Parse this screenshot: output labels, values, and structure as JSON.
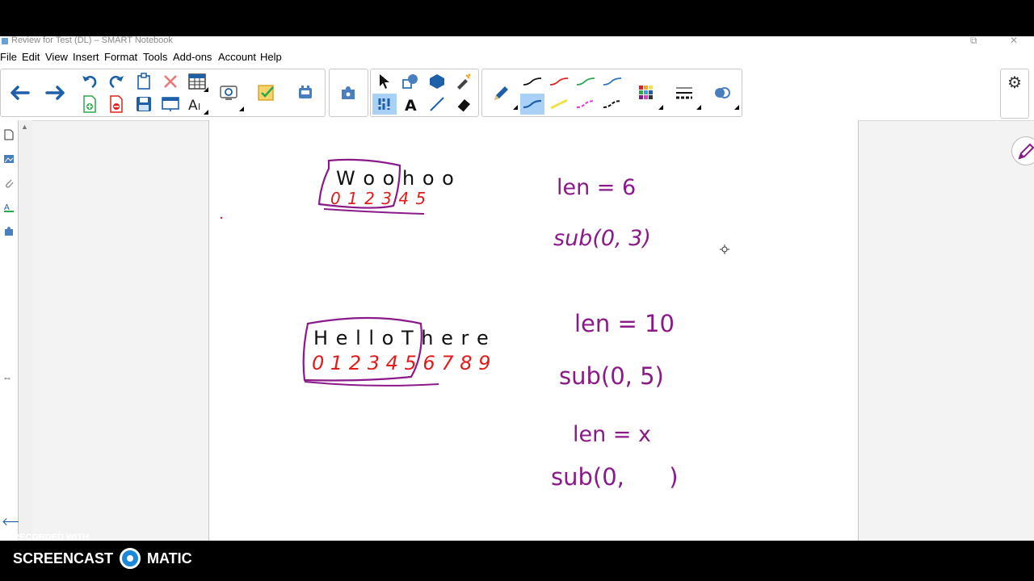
{
  "window": {
    "title": "Review for Test (DL) – SMART Notebook",
    "restore_glyph": "⧉",
    "close_glyph": "✕"
  },
  "menu": [
    "File",
    "Edit",
    "View",
    "Insert",
    "Format",
    "Tools",
    "Add-ons",
    "Account",
    "Help"
  ],
  "toolbar": {
    "icons": {
      "back": "back-arrow-icon",
      "forward": "forward-arrow-icon",
      "undo": "undo-icon",
      "redo": "redo-icon",
      "delete": "delete-icon",
      "table": "table-icon",
      "add_page": "add-page-icon",
      "open": "open-file-icon",
      "save": "save-icon",
      "screen_shade": "screen-shade-icon",
      "full_screen": "full-screen-icon",
      "document_camera": "document-camera-icon",
      "activity_builder": "activity-builder-icon",
      "response": "response-icon",
      "addons": "addons-icon",
      "select": "select-icon",
      "shapes": "shapes-icon",
      "fill": "fill-icon",
      "pens": "pens-icon",
      "text": "text-icon",
      "lines": "lines-icon",
      "eraser": "eraser-icon",
      "pen": "pen-icon",
      "color_palette": "color-palette-icon",
      "line_style": "line-style-icon",
      "properties": "properties-icon",
      "settings": "settings-icon"
    },
    "icon_glyphs": {
      "back": "🡐",
      "forward": "🡒",
      "undo": "↶",
      "redo": "↷",
      "delete": "✕",
      "text": "A",
      "ai_text": "A",
      "select": "➚",
      "shapes": "◐",
      "fill": "⬢",
      "pens": "✐",
      "eraser": "◆",
      "settings": "⚙"
    },
    "colors": {
      "accent_blue": "#2e74c9",
      "delete_red": "#e02020",
      "save_green": "#2aa84a",
      "pen_black": "#000000",
      "pen_red": "#e02020",
      "pen_green": "#2aa84a",
      "pen_blue": "#2e74c9",
      "pen_cyan": "#3a9fd6",
      "pen_yellow": "#f2e24a",
      "pen_magenta": "#d93ed2",
      "selected_bg": "#a9d0f5"
    }
  },
  "sidebar": {
    "icons": [
      "page-sorter-icon",
      "gallery-icon",
      "attachments-icon",
      "properties-icon",
      "addons-icon"
    ],
    "collapse_glyph": "⇔",
    "arrow_glyph": "🡐"
  },
  "scrollbar": {
    "up_glyph": "▲"
  },
  "canvas": {
    "ink_colors": {
      "black": "#111111",
      "red": "#e21b1b",
      "purple": "#8a1a8a"
    },
    "handwriting": {
      "example1_word": "W o o h o o",
      "example1_indices": "0 1 2 3 4 5",
      "example1_len": "len = 6",
      "example1_sub": "sub(0, 3)",
      "example2_word": "H e l l o T h e r e",
      "example2_indices": "0 1 2 3 4 5 6 7 8 9",
      "example2_len": "len = 10",
      "example2_sub": "sub(0, 5)",
      "general_len": "len = x",
      "general_sub": "sub(0,      )"
    }
  },
  "overlay": {
    "recorded_with": "RECORDED WITH",
    "brand_left": "SCREENCAST",
    "brand_right": "MATIC"
  }
}
